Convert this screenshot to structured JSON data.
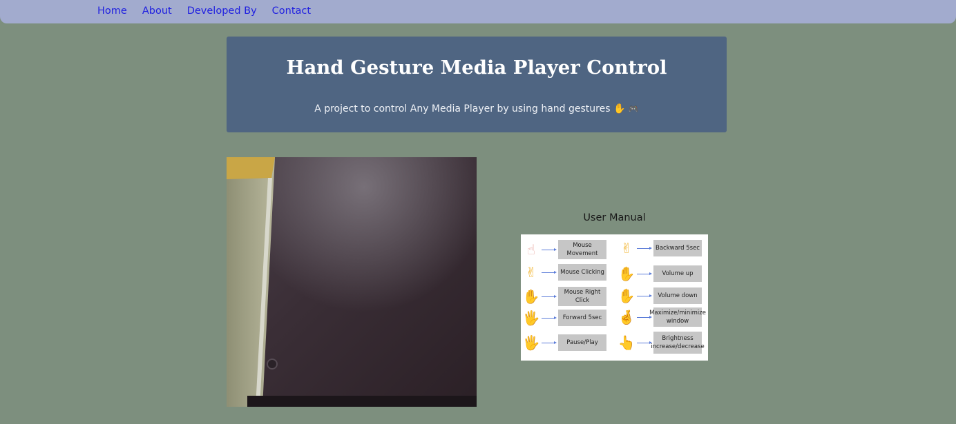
{
  "nav": {
    "links": [
      "Home",
      "About",
      "Developed By",
      "Contact"
    ]
  },
  "hero": {
    "title": "Hand Gesture Media Player Control",
    "subtitle": "A project to control Any Media Player by using hand gestures",
    "subtitle_emoji_1": "✋",
    "subtitle_emoji_2": "🎮"
  },
  "manual": {
    "title": "User Manual",
    "left": [
      {
        "icon": "index-finger-up-icon",
        "glyph": "☝",
        "label": "Mouse Movement"
      },
      {
        "icon": "victory-hand-icon",
        "glyph": "✌",
        "label": "Mouse Clicking"
      },
      {
        "icon": "three-fingers-outline-icon",
        "glyph": "✋",
        "label": "Mouse Right Click"
      },
      {
        "icon": "four-fingers-icon",
        "glyph": "🖐",
        "label": "Forward 5sec"
      },
      {
        "icon": "open-palm-icon",
        "glyph": "🖐",
        "label": "Pause/Play"
      }
    ],
    "right": [
      {
        "icon": "three-fingers-icon",
        "glyph": "✌",
        "label": "Backward 5sec"
      },
      {
        "icon": "hand-outline-up-icon",
        "glyph": "✋",
        "label": "Volume up"
      },
      {
        "icon": "hand-outline-down-icon",
        "glyph": "✋",
        "label": "Volume down"
      },
      {
        "icon": "crossed-hand-icon",
        "glyph": "🤞",
        "label": "Maximize/minimize window"
      },
      {
        "icon": "pointing-hand-icon",
        "glyph": "👆",
        "label": "Brightness increase/decrease"
      }
    ]
  },
  "colors": {
    "background": "#7d8f7e",
    "nav": "#a2abce",
    "hero": "#4f6582",
    "link": "#1f1fe0"
  }
}
